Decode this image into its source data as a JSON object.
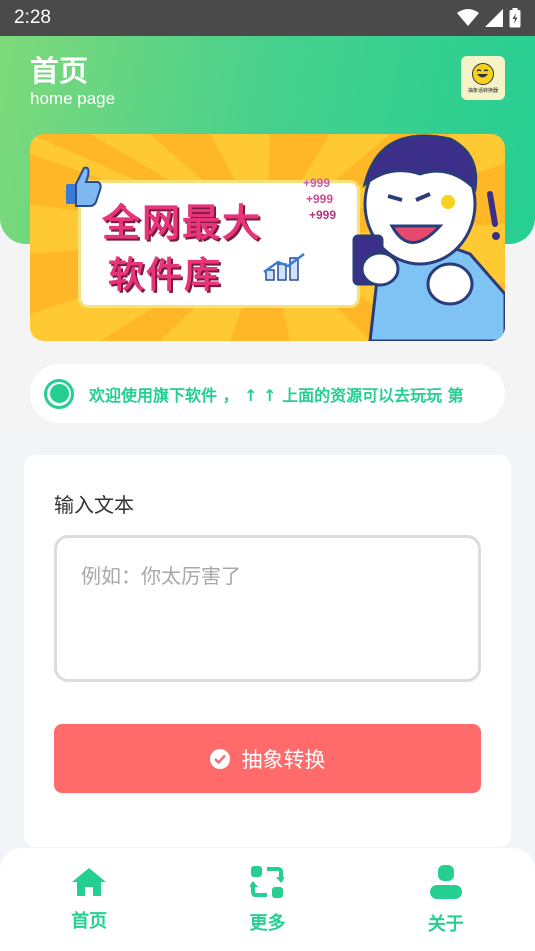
{
  "status_bar": {
    "time": "2:28",
    "icons": [
      "wifi-icon",
      "signal-icon",
      "battery-icon"
    ]
  },
  "header": {
    "title": "首页",
    "subtitle": "home page",
    "logo_text": "抽象话转换器"
  },
  "banner": {
    "line1": "全网最大",
    "line2": "软件库",
    "badges": [
      "+999",
      "+999",
      "+999"
    ]
  },
  "notice": {
    "text": "欢迎使用旗下软件 ， ↑ ↑ 上面的资源可以去玩玩 第"
  },
  "form": {
    "label": "输入文本",
    "placeholder": "例如：你太厉害了",
    "value": "",
    "button_label": "抽象转换"
  },
  "bottom_nav": {
    "items": [
      {
        "label": "首页",
        "icon": "home-icon"
      },
      {
        "label": "更多",
        "icon": "swap-icon"
      },
      {
        "label": "关于",
        "icon": "user-icon"
      }
    ]
  },
  "colors": {
    "accent": "#25cf92",
    "button": "#ff6b6b",
    "header_start": "#7ed97a",
    "header_end": "#25cf92",
    "status_bar": "#4a4a4a"
  }
}
